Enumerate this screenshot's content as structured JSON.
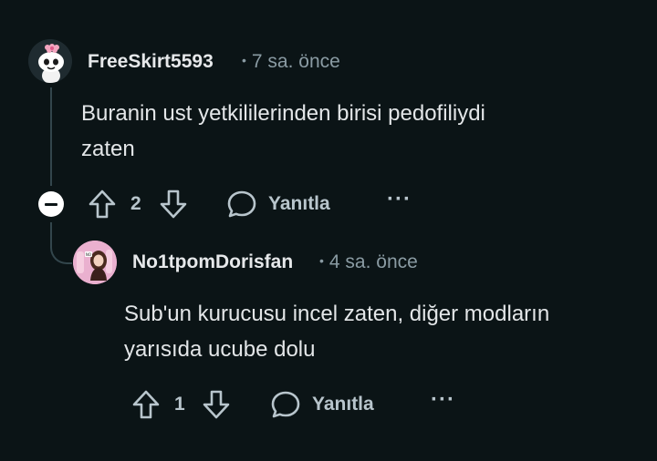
{
  "comments": [
    {
      "username": "FreeSkirt5593",
      "time": "7 sa. önce",
      "body_lines": [
        "Buranin ust yetkililerinden birisi pedofiliydi",
        "zaten"
      ],
      "votes": "2",
      "reply_label": "Yanıtla",
      "more_label": "···",
      "avatar_icon": "snoo-avatar-with-flower"
    },
    {
      "username": "No1tpomDorisfan",
      "time": "4 sa. önce",
      "body_lines": [
        "Sub'un kurucusu incel zaten, diğer modların",
        "yarısıda ucube dolu"
      ],
      "votes": "1",
      "reply_label": "Yanıtla",
      "more_label": "···",
      "avatar_icon": "pink-character-avatar"
    }
  ],
  "meta_separator": "•",
  "colors": {
    "background": "#0b1416",
    "thread_line": "#33464c",
    "text": "#e3e6e8",
    "muted": "#8a9ba3",
    "action": "#b8c5cc"
  }
}
